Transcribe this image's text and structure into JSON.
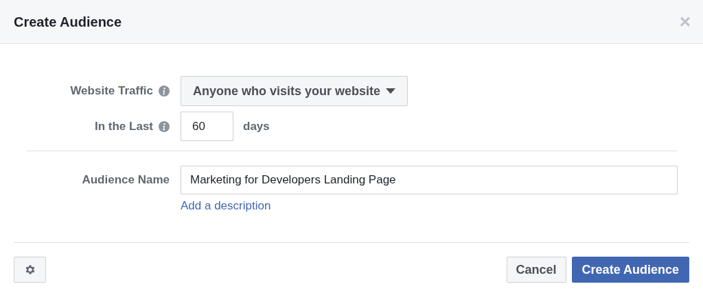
{
  "dialog": {
    "title": "Create Audience",
    "close_label": "×"
  },
  "rows": [
    {
      "kind": "dropdown",
      "label": "Website Traffic",
      "info": true,
      "value": "Anyone who visits your website"
    },
    {
      "kind": "number",
      "label": "In the Last",
      "info": true,
      "value": "60",
      "unit": "days"
    },
    {
      "kind": "divider"
    },
    {
      "kind": "text",
      "label": "Audience Name",
      "info": false,
      "value": "Marketing for Developers Landing Page",
      "link": "Add a description"
    }
  ],
  "footer": {
    "buttons": [
      {
        "label": "Cancel",
        "primary": false
      },
      {
        "label": "Create Audience",
        "primary": true
      }
    ]
  }
}
